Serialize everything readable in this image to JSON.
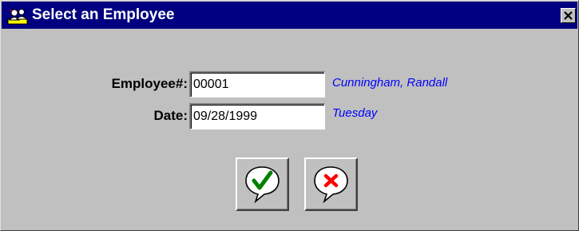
{
  "window": {
    "title": "Select an Employee",
    "icon": "employee-app-icon",
    "close_icon": "close-icon"
  },
  "form": {
    "employee_label": "Employee#:",
    "employee_value": "00001",
    "employee_name": "Cunningham, Randall",
    "date_label": "Date:",
    "date_value": "09/28/1999",
    "day_name": "Tuesday"
  },
  "buttons": {
    "ok_icon": "checkmark-icon",
    "cancel_icon": "x-icon"
  },
  "colors": {
    "titlebar": "#000080",
    "info_text": "#0000ff",
    "ok": "#008000",
    "cancel": "#ff0000",
    "face": "#c0c0c0"
  }
}
